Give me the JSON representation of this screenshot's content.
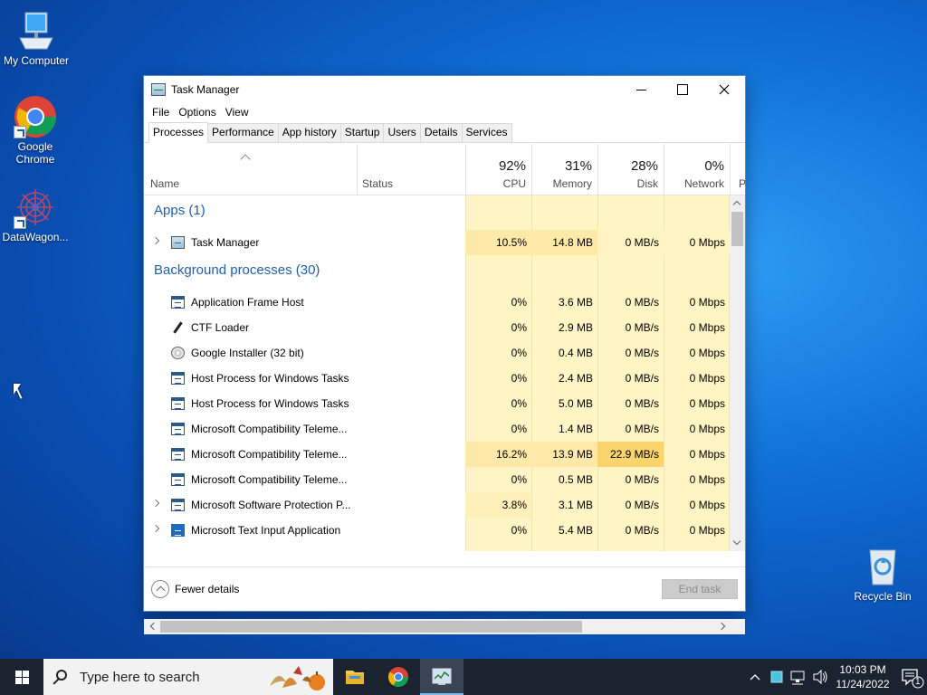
{
  "desktop": {
    "icons": [
      {
        "label": "My Computer"
      },
      {
        "label": "Google Chrome"
      },
      {
        "label": "DataWagon..."
      },
      {
        "label": "Recycle Bin"
      }
    ]
  },
  "window": {
    "title": "Task Manager",
    "menu": [
      "File",
      "Options",
      "View"
    ],
    "tabs": [
      "Processes",
      "Performance",
      "App history",
      "Startup",
      "Users",
      "Details",
      "Services"
    ],
    "active_tab": "Processes",
    "columns": {
      "name": "Name",
      "status": "Status",
      "cpu": {
        "pct": "92%",
        "label": "CPU"
      },
      "memory": {
        "pct": "31%",
        "label": "Memory"
      },
      "disk": {
        "pct": "28%",
        "label": "Disk"
      },
      "network": {
        "pct": "0%",
        "label": "Network"
      },
      "power_partial": "P"
    },
    "groups": {
      "apps": "Apps (1)",
      "background": "Background processes (30)"
    },
    "apps": [
      {
        "name": "Task Manager",
        "icon": "task-manager-icon",
        "expandable": true,
        "cpu": "10.5%",
        "memory": "14.8 MB",
        "disk": "0 MB/s",
        "network": "0 Mbps"
      }
    ],
    "background": [
      {
        "name": "Application Frame Host",
        "icon": "window-app-icon",
        "expandable": false,
        "cpu": "0%",
        "memory": "3.6 MB",
        "disk": "0 MB/s",
        "network": "0 Mbps"
      },
      {
        "name": "CTF Loader",
        "icon": "pen-icon",
        "expandable": false,
        "cpu": "0%",
        "memory": "2.9 MB",
        "disk": "0 MB/s",
        "network": "0 Mbps"
      },
      {
        "name": "Google Installer (32 bit)",
        "icon": "disc-icon",
        "expandable": false,
        "cpu": "0%",
        "memory": "0.4 MB",
        "disk": "0 MB/s",
        "network": "0 Mbps"
      },
      {
        "name": "Host Process for Windows Tasks",
        "icon": "window-app-icon",
        "expandable": false,
        "cpu": "0%",
        "memory": "2.4 MB",
        "disk": "0 MB/s",
        "network": "0 Mbps"
      },
      {
        "name": "Host Process for Windows Tasks",
        "icon": "window-app-icon",
        "expandable": false,
        "cpu": "0%",
        "memory": "5.0 MB",
        "disk": "0 MB/s",
        "network": "0 Mbps"
      },
      {
        "name": "Microsoft Compatibility Teleme...",
        "icon": "window-app-icon",
        "expandable": false,
        "cpu": "0%",
        "memory": "1.4 MB",
        "disk": "0 MB/s",
        "network": "0 Mbps"
      },
      {
        "name": "Microsoft Compatibility Teleme...",
        "icon": "window-app-icon",
        "expandable": false,
        "cpu": "16.2%",
        "memory": "13.9 MB",
        "disk": "22.9 MB/s",
        "network": "0 Mbps"
      },
      {
        "name": "Microsoft Compatibility Teleme...",
        "icon": "window-app-icon",
        "expandable": false,
        "cpu": "0%",
        "memory": "0.5 MB",
        "disk": "0 MB/s",
        "network": "0 Mbps"
      },
      {
        "name": "Microsoft Software Protection P...",
        "icon": "window-app-icon",
        "expandable": true,
        "cpu": "3.8%",
        "memory": "3.1 MB",
        "disk": "0 MB/s",
        "network": "0 Mbps"
      },
      {
        "name": "Microsoft Text Input Application",
        "icon": "keyboard-icon",
        "expandable": true,
        "cpu": "0%",
        "memory": "5.4 MB",
        "disk": "0 MB/s",
        "network": "0 Mbps"
      }
    ],
    "footer": {
      "fewer_details": "Fewer details",
      "end_task": "End task"
    }
  },
  "taskbar": {
    "search_placeholder": "Type here to search",
    "time": "10:03 PM",
    "date": "11/24/2022",
    "notification_count": "1"
  },
  "colors": {
    "heat_light": "#fff4c4",
    "heat_medium": "#ffe9a8",
    "heat_strong": "#fcd46e",
    "group_title": "#2260a8",
    "accent": "#0078d7"
  }
}
